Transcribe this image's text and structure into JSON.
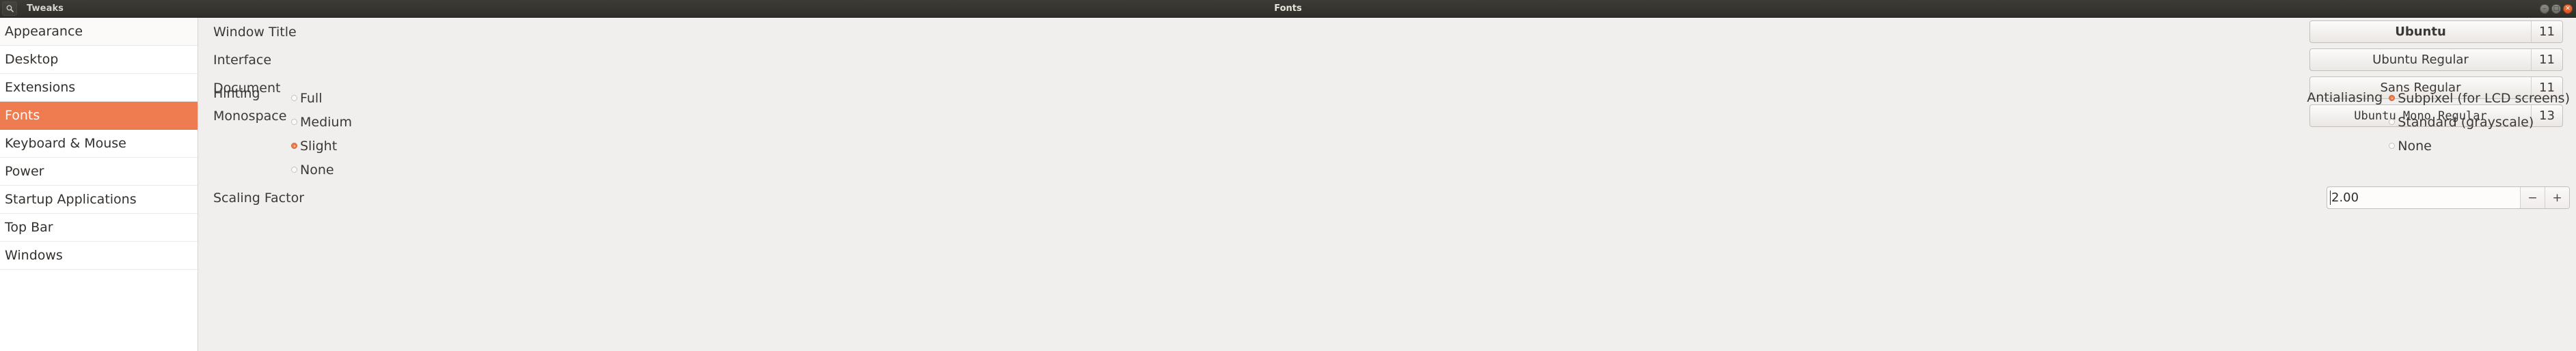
{
  "titlebar": {
    "search_icon": "search-icon",
    "app_name": "Tweaks",
    "page_title": "Fonts",
    "minimize_label": "–",
    "maximize_label": "□",
    "close_label": "✕"
  },
  "sidebar": {
    "items": [
      {
        "label": "Appearance",
        "selected": false
      },
      {
        "label": "Desktop",
        "selected": false
      },
      {
        "label": "Extensions",
        "selected": false
      },
      {
        "label": "Fonts",
        "selected": true
      },
      {
        "label": "Keyboard & Mouse",
        "selected": false
      },
      {
        "label": "Power",
        "selected": false
      },
      {
        "label": "Startup Applications",
        "selected": false
      },
      {
        "label": "Top Bar",
        "selected": false
      },
      {
        "label": "Windows",
        "selected": false
      }
    ],
    "selected_color": "#ef7b50"
  },
  "fonts": {
    "rows": [
      {
        "label": "Window Title",
        "font_name": "Ubuntu",
        "size": "11",
        "style": "bold"
      },
      {
        "label": "Interface",
        "font_name": "Ubuntu Regular",
        "size": "11",
        "style": "regular"
      },
      {
        "label": "Document",
        "font_name": "Sans Regular",
        "size": "11",
        "style": "regular"
      },
      {
        "label": "Monospace",
        "font_name": "Ubuntu Mono Regular",
        "size": "13",
        "style": "mono"
      }
    ]
  },
  "hinting": {
    "label": "Hinting",
    "options": [
      {
        "label": "Full",
        "selected": false
      },
      {
        "label": "Medium",
        "selected": false
      },
      {
        "label": "Slight",
        "selected": true
      },
      {
        "label": "None",
        "selected": false
      }
    ]
  },
  "antialiasing": {
    "label": "Antialiasing",
    "options": [
      {
        "label": "Subpixel (for LCD screens)",
        "selected": true
      },
      {
        "label": "Standard (grayscale)",
        "selected": false
      },
      {
        "label": "None",
        "selected": false
      }
    ]
  },
  "scaling": {
    "label": "Scaling Factor",
    "value": "2.00",
    "decrement_label": "−",
    "increment_label": "+"
  }
}
